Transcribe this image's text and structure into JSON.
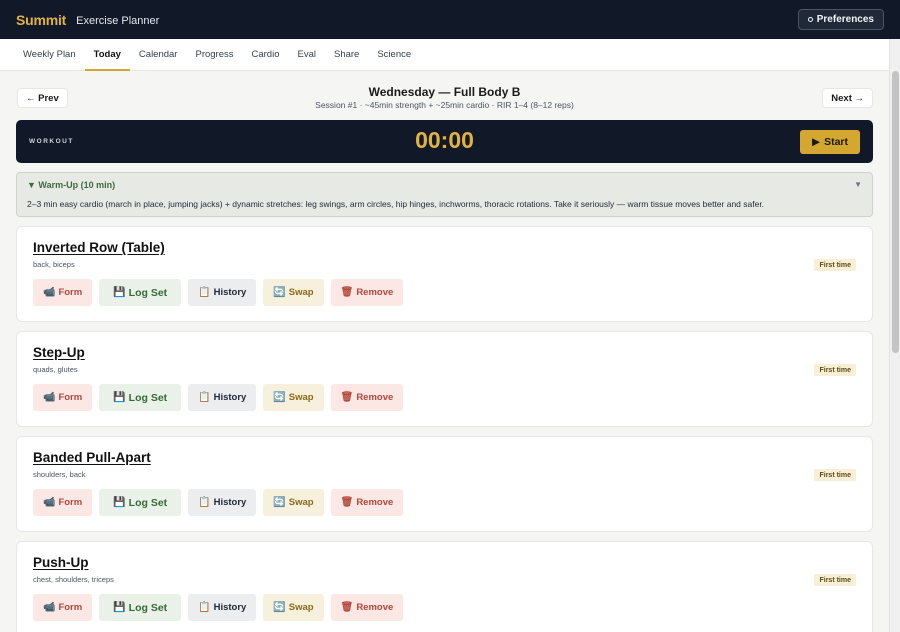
{
  "header": {
    "logo": "Summit",
    "title": "Exercise Planner",
    "preferences_label": "Preferences"
  },
  "tabs": [
    {
      "label": "Weekly Plan",
      "active": false
    },
    {
      "label": "Today",
      "active": true
    },
    {
      "label": "Calendar",
      "active": false
    },
    {
      "label": "Progress",
      "active": false
    },
    {
      "label": "Cardio",
      "active": false
    },
    {
      "label": "Eval",
      "active": false
    },
    {
      "label": "Share",
      "active": false
    },
    {
      "label": "Science",
      "active": false
    }
  ],
  "session": {
    "prev_label": "← Prev",
    "next_label": "Next →",
    "title": "Wednesday — Full Body B",
    "subtitle": "Session #1 · ~45min strength + ~25min cardio · RIR 1–4 (8–12 reps)"
  },
  "timer": {
    "label": "WORKOUT",
    "value": "00:00",
    "start_label": "Start",
    "start_icon": "▶"
  },
  "warmup": {
    "title": "▼ Warm-Up (10 min)",
    "caret": "▼",
    "text": "2–3 min easy cardio (march in place, jumping jacks) + dynamic stretches: leg swings, arm circles, hip hinges, inchworms, thoracic rotations. Take it seriously — warm tissue moves better and safer."
  },
  "actions": {
    "form": {
      "label": "Form",
      "icon": "📹"
    },
    "log": {
      "label": "Log Set",
      "icon": "💾"
    },
    "history": {
      "label": "History",
      "icon": "📋"
    },
    "swap": {
      "label": "Swap",
      "icon": "🔄"
    },
    "remove": {
      "label": "Remove",
      "icon": "🗑"
    }
  },
  "exercises": [
    {
      "name": "Inverted Row (Table)",
      "muscles": "back, biceps",
      "badge": "First time"
    },
    {
      "name": "Step-Up",
      "muscles": "quads, glutes",
      "badge": "First time"
    },
    {
      "name": "Banded Pull-Apart",
      "muscles": "shoulders, back",
      "badge": "First time"
    },
    {
      "name": "Push-Up",
      "muscles": "chest, shoulders, triceps",
      "badge": "First time"
    }
  ],
  "colors": {
    "header_bg": "#111827",
    "accent": "#e0b341",
    "form": "#b5473b",
    "log": "#356b35",
    "swap": "#8a6a1a"
  }
}
